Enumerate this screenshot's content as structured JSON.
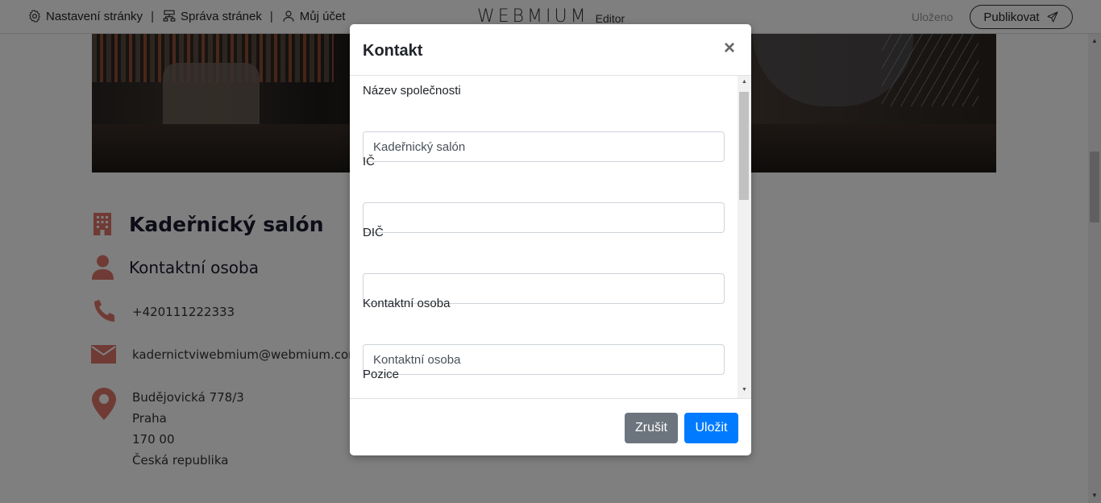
{
  "toolbar": {
    "page_settings": "Nastavení stránky",
    "page_management": "Správa stránek",
    "my_account": "Můj účet",
    "separator": "|",
    "logo": "WEBMIUM",
    "logo_sub": "Editor",
    "status": "Uloženo",
    "publish": "Publikovat"
  },
  "page": {
    "company_name": "Kadeřnický salón",
    "contact_person": "Kontaktní osoba",
    "phone": "+420111222333",
    "email": "kadernictviwebmium@webmium.com",
    "address": [
      "Budějovická 778/3",
      "Praha",
      "170 00",
      "Česká republika"
    ]
  },
  "modal": {
    "title": "Kontakt",
    "close": "×",
    "fields": [
      {
        "label": "Název společnosti",
        "value": "Kadeřnický salón"
      },
      {
        "label": "IČ",
        "value": ""
      },
      {
        "label": "DIČ",
        "value": ""
      },
      {
        "label": "Kontaktní osoba",
        "value": "Kontaktní osoba"
      },
      {
        "label": "Pozice",
        "value": ""
      }
    ],
    "cancel": "Zrušit",
    "save": "Uložit"
  },
  "colors": {
    "accent_icon": "#e0776a",
    "primary": "#007bff",
    "secondary": "#6c757d"
  },
  "icons": [
    "gear-icon",
    "sitemap-icon",
    "user-icon",
    "send-icon",
    "building-icon",
    "person-icon",
    "phone-icon",
    "envelope-icon",
    "map-pin-icon",
    "close-icon"
  ]
}
